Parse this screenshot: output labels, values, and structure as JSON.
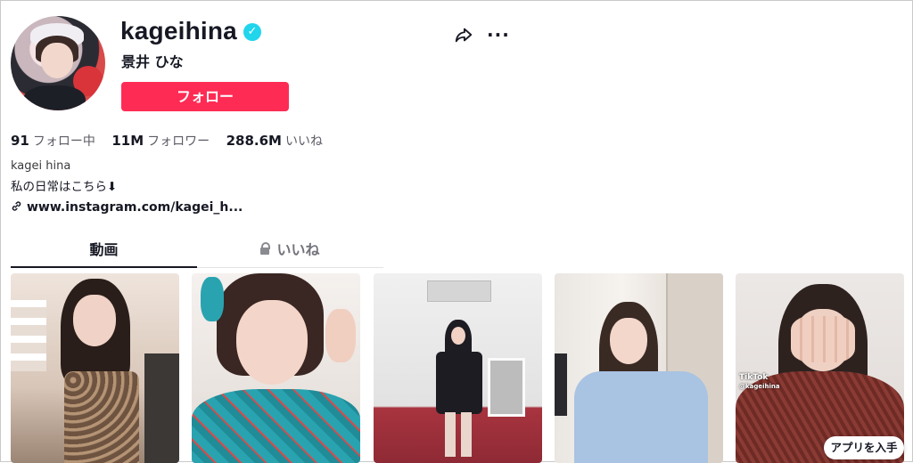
{
  "profile": {
    "username": "kageihina",
    "nickname": "景井 ひな",
    "follow_label": "フォロー",
    "verified_mark": "✓"
  },
  "stats": {
    "following": {
      "value": "91",
      "label": "フォロー中"
    },
    "followers": {
      "value": "11M",
      "label": "フォロワー"
    },
    "likes": {
      "value": "288.6M",
      "label": "いいね"
    }
  },
  "bio": {
    "name": "kagei hina",
    "line": "私の日常はこちら⬇",
    "link": "www.instagram.com/kagei_h..."
  },
  "tabs": [
    {
      "label": "動画",
      "active": true
    },
    {
      "label": "いいね",
      "active": false
    }
  ],
  "videos": [
    {
      "palette": [
        "#efe4dc",
        "#b59475",
        "#2a1e1a"
      ]
    },
    {
      "palette": [
        "#f1ede9",
        "#2aa3b0",
        "#3a2622"
      ]
    },
    {
      "palette": [
        "#ededed",
        "#1c1c22",
        "#9b2a3a"
      ]
    },
    {
      "palette": [
        "#f4efe9",
        "#a9c3e2",
        "#3a2a24"
      ]
    },
    {
      "palette": [
        "#e9e4e2",
        "#8a3b34",
        "#2e221f"
      ],
      "overlay": "TikTok",
      "overlay_user": "@kageihina"
    }
  ],
  "get_app_label": "アプリを入手",
  "icons": {
    "share": "share-icon",
    "more": "more-icon",
    "verified": "verified-badge-icon",
    "link": "link-icon",
    "lock": "lock-icon"
  },
  "colors": {
    "accent": "#fe2c55",
    "verified": "#20d5ec"
  }
}
